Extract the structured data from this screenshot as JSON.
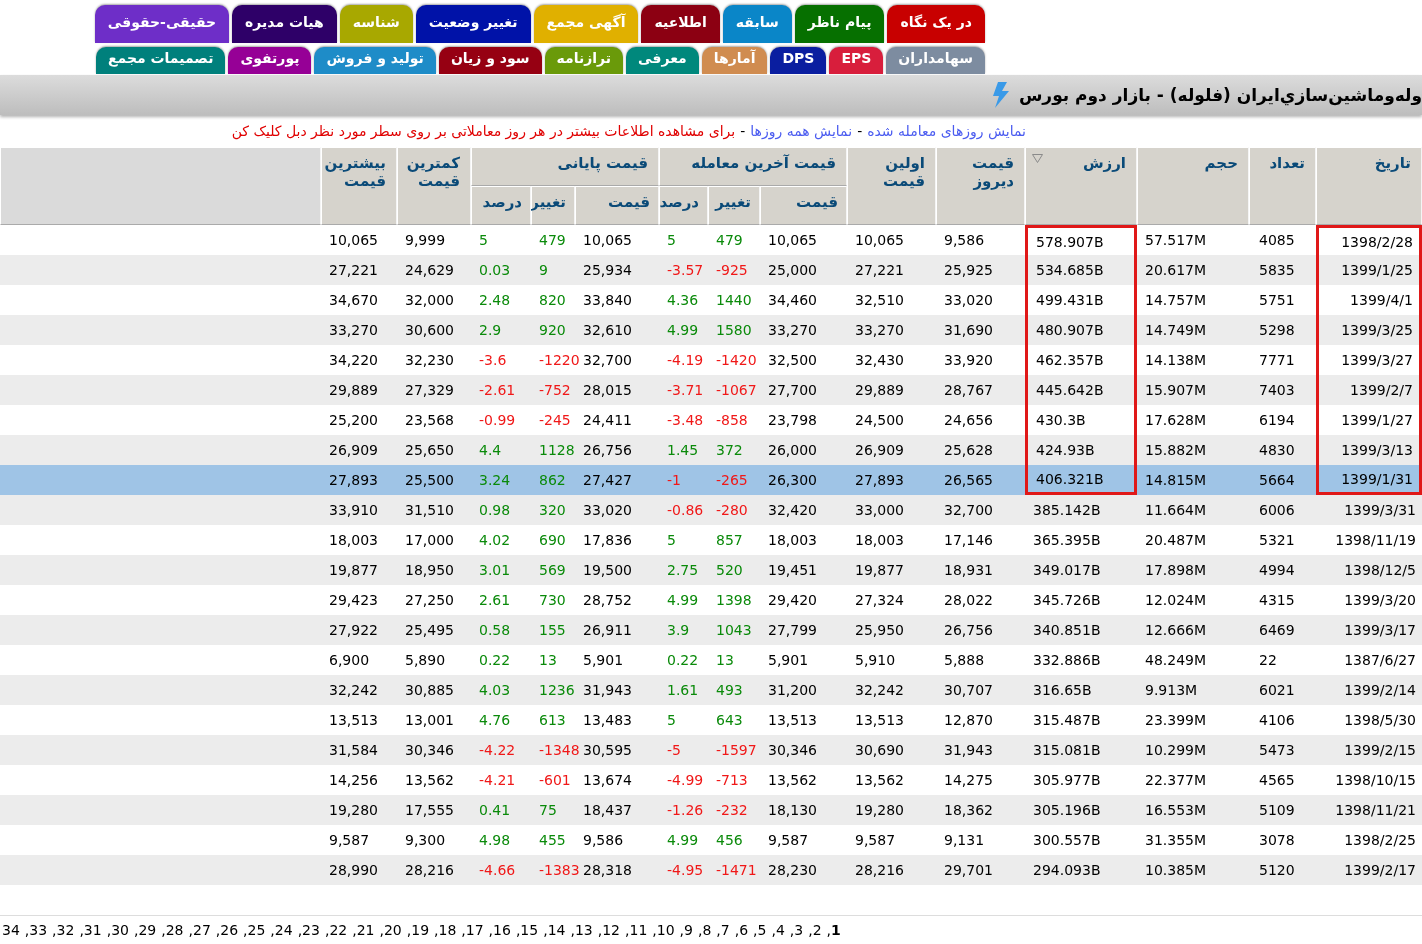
{
  "tabs_top_row": [
    {
      "label": "در یک نگاه",
      "color": "#c80000"
    },
    {
      "label": "پیام ناظر",
      "color": "#067000"
    },
    {
      "label": "سابقه",
      "color": "#0a86c8"
    },
    {
      "label": "اطلاعیه",
      "color": "#8c0012"
    },
    {
      "label": "آگهی مجمع",
      "color": "#e0b000"
    },
    {
      "label": "تغییر وضعیت",
      "color": "#0012a8"
    },
    {
      "label": "شناسه",
      "color": "#a8a800"
    },
    {
      "label": "هیات مدیره",
      "color": "#2e0068"
    },
    {
      "label": "حقیقی-حقوقی",
      "color": "#6e2ec8"
    }
  ],
  "tabs_bottom_row": [
    {
      "label": "سهامداران",
      "color": "#7d8ca0"
    },
    {
      "label": "EPS",
      "color": "#d81e3c"
    },
    {
      "label": "DPS",
      "color": "#0a1ea0"
    },
    {
      "label": "آمارها",
      "color": "#d08c50"
    },
    {
      "label": "معرفی",
      "color": "#00887c"
    },
    {
      "label": "ترازنامه",
      "color": "#6a9a0a"
    },
    {
      "label": "سود و زیان",
      "color": "#960012"
    },
    {
      "label": "تولید و فروش",
      "color": "#1e8cc8"
    },
    {
      "label": "پورتفوی",
      "color": "#960096"
    },
    {
      "label": "تصمیمات مجمع",
      "color": "#00807c"
    }
  ],
  "title": "وله‌وماشین‌سازي‌ایران (فلوله) - بازار دوم بورس",
  "links": [
    "نمایش روزهای معامله شده",
    "نمایش همه روزها"
  ],
  "link_separator": "-",
  "hint": "برای مشاهده اطلاعات بیشتر در هر روز معاملاتی بر روی سطر مورد نظر دبل کلیک کن",
  "columns": [
    {
      "label": "تاریخ",
      "marked": true,
      "sorted": false
    },
    {
      "label": "تعداد",
      "marked": false,
      "sorted": false
    },
    {
      "label": "حجم",
      "marked": false,
      "sorted": false
    },
    {
      "label": "ارزش",
      "marked": true,
      "sorted": true
    },
    {
      "label": "قیمت دیروز",
      "marked": false,
      "sorted": false
    },
    {
      "label": "اولین قیمت",
      "marked": false,
      "sorted": false
    },
    {
      "label": "قیمت آخرین معامله",
      "kind": "last",
      "sub": [
        {
          "label": "قیمت",
          "kind": "price"
        },
        {
          "label": "تغییر",
          "kind": "change"
        },
        {
          "label": "درصد",
          "kind": "percent"
        }
      ]
    },
    {
      "label": "قیمت پایانی",
      "kind": "close",
      "sub": [
        {
          "label": "قیمت",
          "kind": "price"
        },
        {
          "label": "تغییر",
          "kind": "change"
        },
        {
          "label": "درصد",
          "kind": "percent"
        }
      ]
    },
    {
      "label": "کمترین قیمت",
      "marked": false,
      "sorted": false
    },
    {
      "label": "بیشترین قیمت",
      "marked": false,
      "sorted": false
    }
  ],
  "rows": [
    {
      "cells": [
        "10,065",
        "9,999",
        "5",
        "479",
        "10,065",
        "5",
        "479",
        "10,065",
        "10,065",
        "9,586",
        "578.907B",
        "57.517M",
        "4085",
        "1398/2/28"
      ],
      "last_up": true,
      "close_up": true,
      "selected": false,
      "marked": true
    },
    {
      "cells": [
        "27,221",
        "24,629",
        "0.03",
        "9",
        "25,934",
        "-3.57",
        "-925",
        "25,000",
        "27,221",
        "25,925",
        "534.685B",
        "20.617M",
        "5835",
        "1399/1/25"
      ],
      "last_up": false,
      "close_up": true,
      "selected": false,
      "marked": true
    },
    {
      "cells": [
        "34,670",
        "32,000",
        "2.48",
        "820",
        "33,840",
        "4.36",
        "1440",
        "34,460",
        "32,510",
        "33,020",
        "499.431B",
        "14.757M",
        "5751",
        "1399/4/1"
      ],
      "last_up": true,
      "close_up": true,
      "selected": false,
      "marked": true
    },
    {
      "cells": [
        "33,270",
        "30,600",
        "2.9",
        "920",
        "32,610",
        "4.99",
        "1580",
        "33,270",
        "33,270",
        "31,690",
        "480.907B",
        "14.749M",
        "5298",
        "1399/3/25"
      ],
      "last_up": true,
      "close_up": true,
      "selected": false,
      "marked": true
    },
    {
      "cells": [
        "34,220",
        "32,230",
        "-3.6",
        "-1220",
        "32,700",
        "-4.19",
        "-1420",
        "32,500",
        "32,430",
        "33,920",
        "462.357B",
        "14.138M",
        "7771",
        "1399/3/27"
      ],
      "last_up": false,
      "close_up": false,
      "selected": false,
      "marked": true
    },
    {
      "cells": [
        "29,889",
        "27,329",
        "-2.61",
        "-752",
        "28,015",
        "-3.71",
        "-1067",
        "27,700",
        "29,889",
        "28,767",
        "445.642B",
        "15.907M",
        "7403",
        "1399/2/7"
      ],
      "last_up": false,
      "close_up": false,
      "selected": false,
      "marked": true
    },
    {
      "cells": [
        "25,200",
        "23,568",
        "-0.99",
        "-245",
        "24,411",
        "-3.48",
        "-858",
        "23,798",
        "24,500",
        "24,656",
        "430.3B",
        "17.628M",
        "6194",
        "1399/1/27"
      ],
      "last_up": false,
      "close_up": false,
      "selected": false,
      "marked": true
    },
    {
      "cells": [
        "26,909",
        "25,650",
        "4.4",
        "1128",
        "26,756",
        "1.45",
        "372",
        "26,000",
        "26,909",
        "25,628",
        "424.93B",
        "15.882M",
        "4830",
        "1399/3/13"
      ],
      "last_up": true,
      "close_up": true,
      "selected": false,
      "marked": true
    },
    {
      "cells": [
        "27,893",
        "25,500",
        "3.24",
        "862",
        "27,427",
        "-1",
        "-265",
        "26,300",
        "27,893",
        "26,565",
        "406.321B",
        "14.815M",
        "5664",
        "1399/1/31"
      ],
      "last_up": false,
      "close_up": true,
      "selected": true,
      "marked": true
    },
    {
      "cells": [
        "33,910",
        "31,510",
        "0.98",
        "320",
        "33,020",
        "-0.86",
        "-280",
        "32,420",
        "33,000",
        "32,700",
        "385.142B",
        "11.664M",
        "6006",
        "1399/3/31"
      ],
      "last_up": false,
      "close_up": true,
      "selected": false,
      "marked": false
    },
    {
      "cells": [
        "18,003",
        "17,000",
        "4.02",
        "690",
        "17,836",
        "5",
        "857",
        "18,003",
        "18,003",
        "17,146",
        "365.395B",
        "20.487M",
        "5321",
        "1398/11/19"
      ],
      "last_up": true,
      "close_up": true,
      "selected": false,
      "marked": false
    },
    {
      "cells": [
        "19,877",
        "18,950",
        "3.01",
        "569",
        "19,500",
        "2.75",
        "520",
        "19,451",
        "19,877",
        "18,931",
        "349.017B",
        "17.898M",
        "4994",
        "1398/12/5"
      ],
      "last_up": true,
      "close_up": true,
      "selected": false,
      "marked": false
    },
    {
      "cells": [
        "29,423",
        "27,250",
        "2.61",
        "730",
        "28,752",
        "4.99",
        "1398",
        "29,420",
        "27,324",
        "28,022",
        "345.726B",
        "12.024M",
        "4315",
        "1399/3/20"
      ],
      "last_up": true,
      "close_up": true,
      "selected": false,
      "marked": false
    },
    {
      "cells": [
        "27,922",
        "25,495",
        "0.58",
        "155",
        "26,911",
        "3.9",
        "1043",
        "27,799",
        "25,950",
        "26,756",
        "340.851B",
        "12.666M",
        "6469",
        "1399/3/17"
      ],
      "last_up": true,
      "close_up": true,
      "selected": false,
      "marked": false
    },
    {
      "cells": [
        "6,900",
        "5,890",
        "0.22",
        "13",
        "5,901",
        "0.22",
        "13",
        "5,901",
        "5,910",
        "5,888",
        "332.886B",
        "48.249M",
        "22",
        "1387/6/27"
      ],
      "last_up": true,
      "close_up": true,
      "selected": false,
      "marked": false
    },
    {
      "cells": [
        "32,242",
        "30,885",
        "4.03",
        "1236",
        "31,943",
        "1.61",
        "493",
        "31,200",
        "32,242",
        "30,707",
        "316.65B",
        "9.913M",
        "6021",
        "1399/2/14"
      ],
      "last_up": true,
      "close_up": true,
      "selected": false,
      "marked": false
    },
    {
      "cells": [
        "13,513",
        "13,001",
        "4.76",
        "613",
        "13,483",
        "5",
        "643",
        "13,513",
        "13,513",
        "12,870",
        "315.487B",
        "23.399M",
        "4106",
        "1398/5/30"
      ],
      "last_up": true,
      "close_up": true,
      "selected": false,
      "marked": false
    },
    {
      "cells": [
        "31,584",
        "30,346",
        "-4.22",
        "-1348",
        "30,595",
        "-5",
        "-1597",
        "30,346",
        "30,690",
        "31,943",
        "315.081B",
        "10.299M",
        "5473",
        "1399/2/15"
      ],
      "last_up": false,
      "close_up": false,
      "selected": false,
      "marked": false
    },
    {
      "cells": [
        "14,256",
        "13,562",
        "-4.21",
        "-601",
        "13,674",
        "-4.99",
        "-713",
        "13,562",
        "13,562",
        "14,275",
        "305.977B",
        "22.377M",
        "4565",
        "1398/10/15"
      ],
      "last_up": false,
      "close_up": false,
      "selected": false,
      "marked": false
    },
    {
      "cells": [
        "19,280",
        "17,555",
        "0.41",
        "75",
        "18,437",
        "-1.26",
        "-232",
        "18,130",
        "19,280",
        "18,362",
        "305.196B",
        "16.553M",
        "5109",
        "1398/11/21"
      ],
      "last_up": false,
      "close_up": true,
      "selected": false,
      "marked": false
    },
    {
      "cells": [
        "9,587",
        "9,300",
        "4.98",
        "455",
        "9,586",
        "4.99",
        "456",
        "9,587",
        "9,587",
        "9,131",
        "300.557B",
        "31.355M",
        "3078",
        "1398/2/25"
      ],
      "last_up": true,
      "close_up": true,
      "selected": false,
      "marked": false
    },
    {
      "cells": [
        "28,990",
        "28,216",
        "-4.66",
        "-1383",
        "28,318",
        "-4.95",
        "-1471",
        "28,230",
        "28,216",
        "29,701",
        "294.093B",
        "10.385M",
        "5120",
        "1399/2/17"
      ],
      "last_up": false,
      "close_up": false,
      "selected": false,
      "marked": false
    }
  ],
  "page_separator": ",",
  "pages": [
    {
      "label": "34",
      "selected": false
    },
    {
      "label": "33",
      "selected": false
    },
    {
      "label": "32",
      "selected": false
    },
    {
      "label": "31",
      "selected": false
    },
    {
      "label": "30",
      "selected": false
    },
    {
      "label": "29",
      "selected": false
    },
    {
      "label": "28",
      "selected": false
    },
    {
      "label": "27",
      "selected": false
    },
    {
      "label": "26",
      "selected": false
    },
    {
      "label": "25",
      "selected": false
    },
    {
      "label": "24",
      "selected": false
    },
    {
      "label": "23",
      "selected": false
    },
    {
      "label": "22",
      "selected": false
    },
    {
      "label": "21",
      "selected": false
    },
    {
      "label": "20",
      "selected": false
    },
    {
      "label": "19",
      "selected": false
    },
    {
      "label": "18",
      "selected": false
    },
    {
      "label": "17",
      "selected": false
    },
    {
      "label": "16",
      "selected": false
    },
    {
      "label": "15",
      "selected": false
    },
    {
      "label": "14",
      "selected": false
    },
    {
      "label": "13",
      "selected": false
    },
    {
      "label": "12",
      "selected": false
    },
    {
      "label": "11",
      "selected": false
    },
    {
      "label": "10",
      "selected": false
    },
    {
      "label": "9",
      "selected": false
    },
    {
      "label": "8",
      "selected": false
    },
    {
      "label": "7",
      "selected": false
    },
    {
      "label": "6",
      "selected": false
    },
    {
      "label": "5",
      "selected": false
    },
    {
      "label": "4",
      "selected": false
    },
    {
      "label": "3",
      "selected": false
    },
    {
      "label": "2",
      "selected": false
    },
    {
      "label": "1",
      "selected": true
    }
  ]
}
